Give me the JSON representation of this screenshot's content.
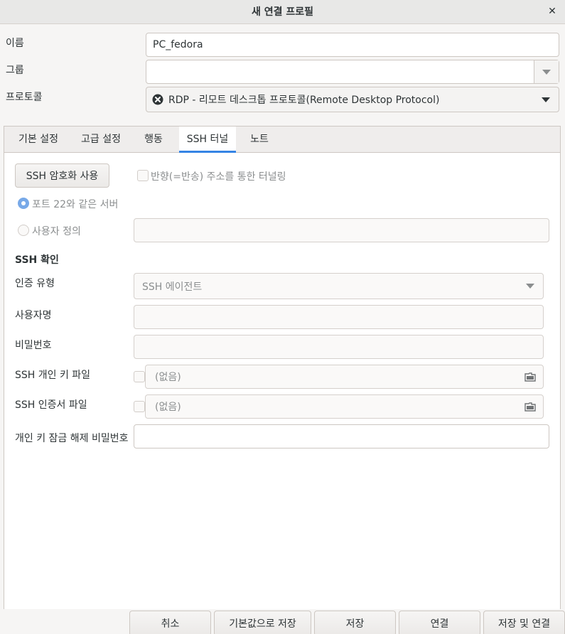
{
  "window": {
    "title": "새 연결 프로필",
    "close_label": "✕"
  },
  "form": {
    "name_label": "이름",
    "name_value": "PC_fedora",
    "group_label": "그룹",
    "group_value": "",
    "protocol_label": "프로토콜",
    "protocol_value": "RDP - 리모트 데스크톱 프로토콜(Remote Desktop Protocol)"
  },
  "tabs": [
    {
      "label": "기본 설정"
    },
    {
      "label": "고급 설정"
    },
    {
      "label": "행동"
    },
    {
      "label": "SSH 터널",
      "active": true
    },
    {
      "label": "노트"
    }
  ],
  "ssh": {
    "enable_button": "SSH 암호화 사용",
    "reverse_tunnel_label": "반향(=반송) 주소를 통한 터널링",
    "same_server_label": "포트 22와 같은 서버",
    "custom_label": "사용자 정의",
    "custom_value": "",
    "auth_section": "SSH 확인",
    "auth_type_label": "인증 유형",
    "auth_type_value": "SSH 에이전트",
    "username_label": "사용자명",
    "username_value": "",
    "password_label": "비밀번호",
    "password_value": "",
    "private_key_label": "SSH 개인 키 파일",
    "private_key_value": "(없음)",
    "cert_label": "SSH 인증서 파일",
    "cert_value": "(없음)",
    "passphrase_label": "개인 키 잠금 해제 비밀번호",
    "passphrase_value": ""
  },
  "footer": {
    "cancel": "취소",
    "save_default": "기본값으로 저장",
    "save": "저장",
    "connect": "연결",
    "save_connect": "저장 및 연결"
  },
  "colors": {
    "accent": "#3584e4"
  }
}
